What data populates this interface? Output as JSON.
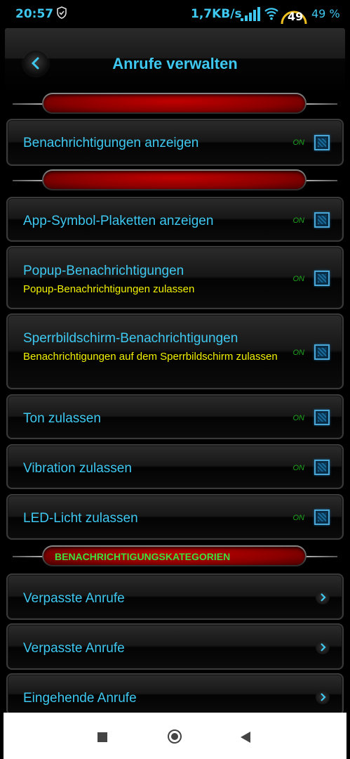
{
  "status_bar": {
    "time": "20:57",
    "net_speed": "1,7KB/s",
    "gauge_value": "49",
    "battery": "49 %"
  },
  "header": {
    "title": "Anrufe verwalten"
  },
  "sections": {
    "category_header": "BENACHRICHTIGUNGSKATEGORIEN"
  },
  "settings": {
    "show_notifications": {
      "title": "Benachrichtigungen anzeigen",
      "state": "ON"
    },
    "badges": {
      "title": "App-Symbol-Plaketten anzeigen",
      "state": "ON"
    },
    "popup": {
      "title": "Popup-Benachrichtigungen",
      "subtitle": "Popup-Benachrichtigungen zulassen",
      "state": "ON"
    },
    "lockscreen": {
      "title": "Sperrbildschirm-Benachrichtigungen",
      "subtitle": "Benachrichtigungen auf dem Sperrbildschirm zulassen",
      "state": "ON"
    },
    "sound": {
      "title": "Ton zulassen",
      "state": "ON"
    },
    "vibration": {
      "title": "Vibration zulassen",
      "state": "ON"
    },
    "led": {
      "title": "LED-Licht zulassen",
      "state": "ON"
    }
  },
  "categories": [
    {
      "title": "Verpasste Anrufe"
    },
    {
      "title": "Verpasste Anrufe"
    },
    {
      "title": "Eingehende Anrufe"
    }
  ],
  "colors": {
    "accent": "#3ec8f0",
    "subtitle": "#f0f000",
    "on_label": "#1fa81f",
    "divider_red": "#a00000",
    "category_text": "#3ee03e"
  }
}
